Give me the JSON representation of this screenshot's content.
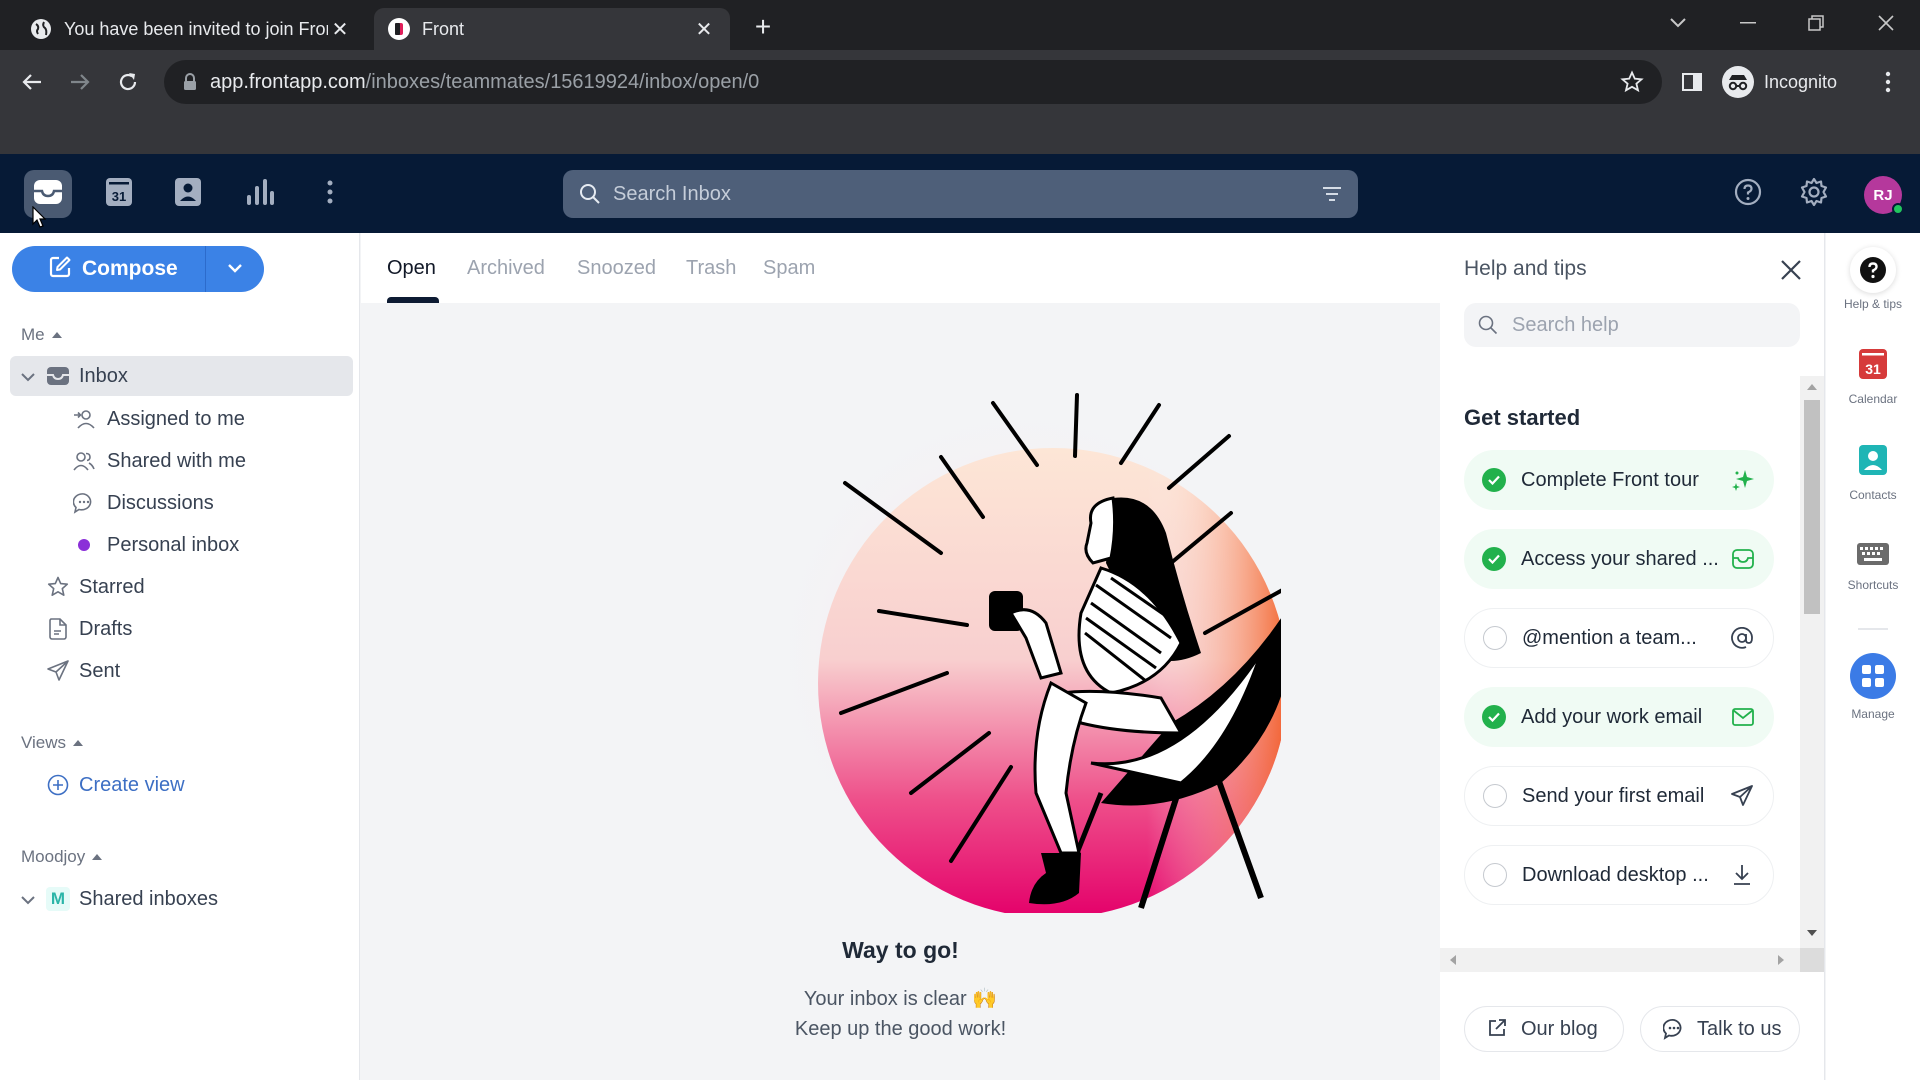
{
  "browser": {
    "tabs": [
      {
        "title": "You have been invited to join Front",
        "favicon": "globe-icon",
        "active": false
      },
      {
        "title": "Front",
        "favicon": "front-logo-icon",
        "active": true
      }
    ],
    "new_tab_label": "+",
    "url_host": "app.frontapp.com",
    "url_path": "/inboxes/teammates/15619924/inbox/open/0",
    "profile_label": "Incognito"
  },
  "appbar": {
    "icons": [
      "inbox-icon",
      "calendar-icon",
      "contacts-icon",
      "analytics-icon",
      "more-icon"
    ],
    "calendar_day": "31",
    "search_placeholder": "Search Inbox",
    "avatar_initials": "RJ",
    "avatar_color": "#b5389c"
  },
  "sidebar": {
    "compose_label": "Compose",
    "me_header": "Me",
    "inbox_label": "Inbox",
    "inbox_children": [
      {
        "label": "Assigned to me",
        "icon": "assign-icon"
      },
      {
        "label": "Shared with me",
        "icon": "users-icon"
      },
      {
        "label": "Discussions",
        "icon": "chat-icon"
      },
      {
        "label": "Personal inbox",
        "icon": "dot-icon",
        "color": "#8b2fd8"
      }
    ],
    "items": [
      {
        "label": "Starred",
        "icon": "star-icon"
      },
      {
        "label": "Drafts",
        "icon": "draft-icon"
      },
      {
        "label": "Sent",
        "icon": "send-icon"
      }
    ],
    "views_header": "Views",
    "create_view_label": "Create view",
    "team_header": "Moodjoy",
    "shared_inboxes_label": "Shared inboxes",
    "team_badge": "M"
  },
  "main": {
    "tabs": [
      "Open",
      "Archived",
      "Snoozed",
      "Trash",
      "Spam"
    ],
    "active_tab": "Open",
    "empty_title": "Way to go!",
    "empty_line1": "Your inbox is clear 🙌",
    "empty_line2": "Keep up the good work!"
  },
  "help": {
    "title": "Help and tips",
    "search_placeholder": "Search help",
    "section_title": "Get started",
    "tasks": [
      {
        "label": "Complete Front tour",
        "done": true,
        "icon": "sparkle-icon"
      },
      {
        "label": "Access your shared ...",
        "done": true,
        "icon": "inbox-icon"
      },
      {
        "label": "@mention a team...",
        "done": false,
        "icon": "at-icon"
      },
      {
        "label": "Add your work email",
        "done": true,
        "icon": "mail-icon"
      },
      {
        "label": "Send your first email",
        "done": false,
        "icon": "send-icon"
      },
      {
        "label": "Download desktop ...",
        "done": false,
        "icon": "download-icon"
      }
    ],
    "blog_label": "Our blog",
    "talk_label": "Talk to us"
  },
  "rail": {
    "items": [
      {
        "label": "Help & tips",
        "icon": "help-icon"
      },
      {
        "label": "Calendar",
        "icon": "calendar-icon",
        "day": "31"
      },
      {
        "label": "Contacts",
        "icon": "contacts-icon"
      },
      {
        "label": "Shortcuts",
        "icon": "keyboard-icon"
      },
      {
        "label": "Manage",
        "icon": "grid-icon"
      }
    ]
  },
  "colors": {
    "accent": "#3b82e6",
    "appbar_bg": "#061a36",
    "success": "#22b14c"
  }
}
